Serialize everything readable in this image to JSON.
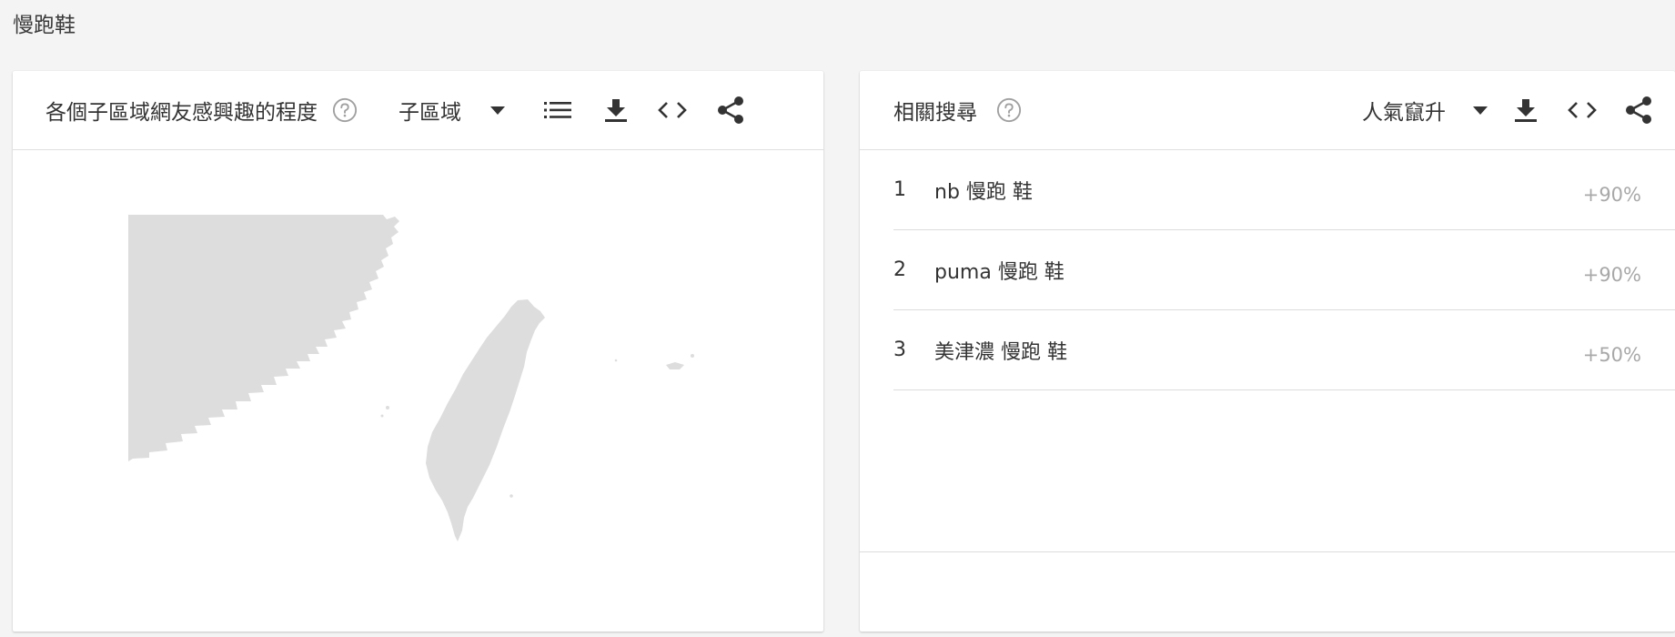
{
  "page": {
    "title": "慢跑鞋"
  },
  "region_card": {
    "title": "各個子區域網友感興趣的程度",
    "help_icon": "question-circle-icon",
    "resolution_dropdown": "子區域",
    "tools": [
      "list-icon",
      "download-icon",
      "embed-code-icon",
      "share-icon"
    ]
  },
  "related_card": {
    "title": "相關搜尋",
    "help_icon": "question-circle-icon",
    "mode_dropdown": "人氣竄升",
    "tools": [
      "download-icon",
      "embed-code-icon",
      "share-icon"
    ],
    "items": [
      {
        "rank": "1",
        "term": "nb 慢跑 鞋",
        "value": "+90%"
      },
      {
        "rank": "2",
        "term": "puma 慢跑 鞋",
        "value": "+90%"
      },
      {
        "rank": "3",
        "term": "美津濃 慢跑 鞋",
        "value": "+50%"
      }
    ]
  },
  "colors": {
    "background": "#f4f4f4",
    "card": "#ffffff",
    "icon": "#333333",
    "help": "#a0a0a0",
    "map_land": "#dddddd",
    "muted_value": "#a8a8a8"
  }
}
